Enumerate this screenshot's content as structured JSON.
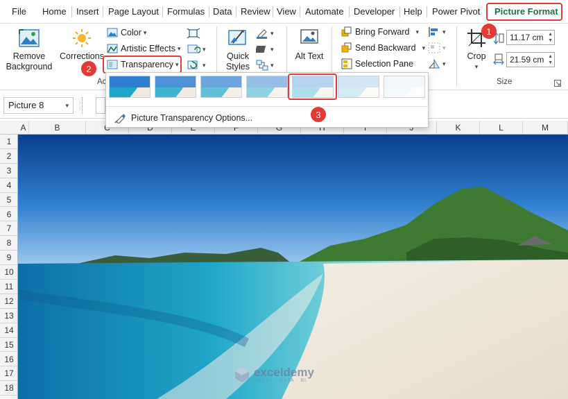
{
  "menu": {
    "tabs": [
      "File",
      "Home",
      "Insert",
      "Page Layout",
      "Formulas",
      "Data",
      "Review",
      "View",
      "Automate",
      "Developer",
      "Help",
      "Power Pivot",
      "Picture Format"
    ],
    "active_tab": "Picture Format"
  },
  "ribbon": {
    "remove_background": "Remove Background",
    "corrections": "Corrections",
    "adjust_group_partial": "Ac",
    "color": "Color",
    "artistic_effects": "Artistic Effects",
    "transparency": "Transparency",
    "quick_styles": "Quick Styles",
    "alt_text": "Alt Text",
    "bring_forward": "Bring Forward",
    "send_backward": "Send Backward",
    "selection_pane": "Selection Pane",
    "crop": "Crop",
    "height_value": "11.17 cm",
    "width_value": "21.59 cm",
    "size_group": "Size"
  },
  "formula_bar": {
    "name_box": "Picture 8"
  },
  "grid": {
    "columns": [
      "A",
      "B",
      "C",
      "D",
      "E",
      "F",
      "G",
      "H",
      "I",
      "J",
      "K",
      "L",
      "M"
    ],
    "rows": [
      "1",
      "2",
      "3",
      "4",
      "5",
      "6",
      "7",
      "8",
      "9",
      "10",
      "11",
      "12",
      "13",
      "14",
      "15",
      "16",
      "17",
      "18"
    ]
  },
  "transparency_menu": {
    "presets": [
      "0%",
      "15%",
      "30%",
      "50%",
      "65%",
      "80%",
      "95%"
    ],
    "highlighted_preset": "50%",
    "options_label": "Picture Transparency Options..."
  },
  "callouts": [
    "1",
    "2",
    "3"
  ],
  "watermark": {
    "name": "exceldemy",
    "tagline": "EXCEL · DATA · BI"
  },
  "colors": {
    "accent_green": "#1e7145",
    "highlight_red": "#e23b3b",
    "badge_red": "#e53935"
  }
}
